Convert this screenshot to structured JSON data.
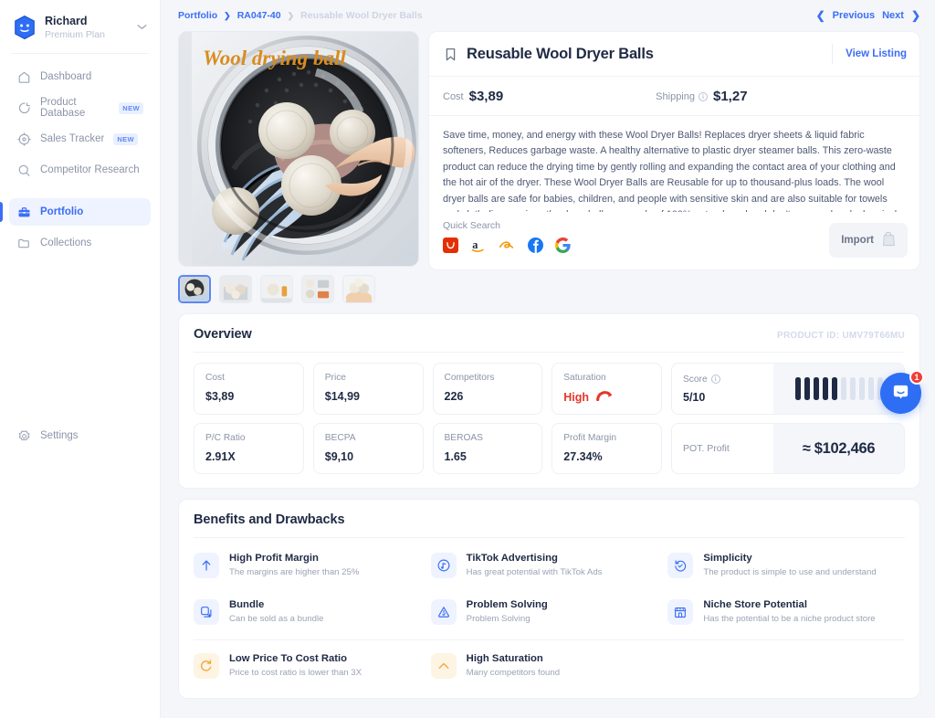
{
  "sidebar": {
    "user": {
      "name": "Richard",
      "plan": "Premium Plan",
      "caret": "chevron-down-icon"
    },
    "items": [
      {
        "label": "Dashboard",
        "icon": "home-icon",
        "badge": "",
        "active": false
      },
      {
        "label": "Product Database",
        "icon": "chart-pie-icon",
        "badge": "NEW",
        "active": false
      },
      {
        "label": "Sales Tracker",
        "icon": "target-icon",
        "badge": "NEW",
        "active": false
      },
      {
        "label": "Competitor Research",
        "icon": "search-icon",
        "badge": "",
        "active": false
      },
      {
        "label": "Portfolio",
        "icon": "briefcase-icon",
        "badge": "",
        "active": true
      },
      {
        "label": "Collections",
        "icon": "folder-icon",
        "badge": "",
        "active": false
      }
    ],
    "settings": {
      "label": "Settings",
      "icon": "gear-icon"
    }
  },
  "topbar": {
    "breadcrumb": {
      "root": "Portfolio",
      "mid": "RA047-40",
      "current": "Reusable Wool Dryer Balls"
    },
    "previous_label": "Previous",
    "next_label": "Next"
  },
  "gallery": {
    "hero_caption": "Wool drying ball",
    "thumbnails": [
      "thumb-1-dryer-drum",
      "thumb-2-balls-basket",
      "thumb-3-balls-oils",
      "thumb-4-balls-package",
      "thumb-5-hands-balls"
    ],
    "selected_thumb": 0
  },
  "product": {
    "title": "Reusable Wool Dryer Balls",
    "bookmark_icon": "bookmark-icon",
    "view_listing": "View Listing",
    "cost_label": "Cost",
    "cost_value": "$3,89",
    "shipping_label": "Shipping",
    "shipping_value": "$1,27",
    "description": "Save time, money, and energy with these Wool Dryer Balls! Replaces dryer sheets & liquid fabric softeners, Reduces garbage waste. A healthy alternative to plastic dryer steamer balls. This zero-waste product can reduce the drying time by gently rolling and expanding the contact area of your clothing and the hot air of the dryer. These Wool Dryer Balls are Reusable for up to thousand-plus loads. The wool dryer balls are safe for babies, children, and people with sensitive skin and are also suitable for towels and cloth diapers since the dryer balls are made of 100% natural wool and don't use any harsh chemicals. These dryer balls can effectively avoid clothing entanglement, reduce",
    "quick_search_label": "Quick Search",
    "quick_search_icons": [
      "aliexpress-icon",
      "amazon-icon",
      "alibaba-icon",
      "facebook-icon",
      "google-icon"
    ],
    "import_label": "Import",
    "import_icon": "shopify-bag-icon"
  },
  "overview": {
    "title": "Overview",
    "product_id": "PRODUCT ID: UMV79T66MU",
    "row1": [
      {
        "label": "Cost",
        "value": "$3,89"
      },
      {
        "label": "Price",
        "value": "$14,99"
      },
      {
        "label": "Competitors",
        "value": "226"
      },
      {
        "label": "Saturation",
        "value": "High",
        "accent": "#e5372a",
        "icon": "gauge-icon"
      }
    ],
    "score": {
      "label": "Score",
      "value": "5/10",
      "filled": 5,
      "total": 10,
      "info_icon": "info-icon"
    },
    "row2": [
      {
        "label": "P/C Ratio",
        "value": "2.91X"
      },
      {
        "label": "BECPA",
        "value": "$9,10"
      },
      {
        "label": "BEROAS",
        "value": "1.65"
      },
      {
        "label": "Profit Margin",
        "value": "27.34%"
      }
    ],
    "pot_profit": {
      "label": "POT. Profit",
      "value": "≈ $102,466"
    }
  },
  "benefits": {
    "title": "Benefits and Drawbacks",
    "positive": [
      {
        "title": "High Profit Margin",
        "subtitle": "The margins are higher than 25%",
        "icon": "arrow-up-icon",
        "tone": "blue"
      },
      {
        "title": "TikTok Advertising",
        "subtitle": "Has great potential with TikTok Ads",
        "icon": "music-note-circle-icon",
        "tone": "blue"
      },
      {
        "title": "Simplicity",
        "subtitle": "The product is simple to use and understand",
        "icon": "history-rotate-icon",
        "tone": "blue"
      },
      {
        "title": "Bundle",
        "subtitle": "Can be sold as a bundle",
        "icon": "copy-plus-icon",
        "tone": "blue"
      },
      {
        "title": "Problem Solving",
        "subtitle": "Problem Solving",
        "icon": "alert-check-icon",
        "tone": "blue"
      },
      {
        "title": "Niche Store Potential",
        "subtitle": "Has the potential to be a niche product store",
        "icon": "storefront-icon",
        "tone": "blue"
      }
    ],
    "negative": [
      {
        "title": "Low Price To Cost Ratio",
        "subtitle": "Price to cost ratio is lower than 3X",
        "icon": "refresh-icon",
        "tone": "warn"
      },
      {
        "title": "High Saturation",
        "subtitle": "Many competitors found",
        "icon": "chevron-up-icon",
        "tone": "warn"
      }
    ]
  },
  "chat": {
    "icon": "chat-bubble-icon",
    "badge": "1"
  },
  "colors": {
    "accent": "#3b6ef5",
    "danger": "#e5372a",
    "warn": "#f0a836",
    "ink": "#1f2a44",
    "muted": "#8b94a8"
  }
}
